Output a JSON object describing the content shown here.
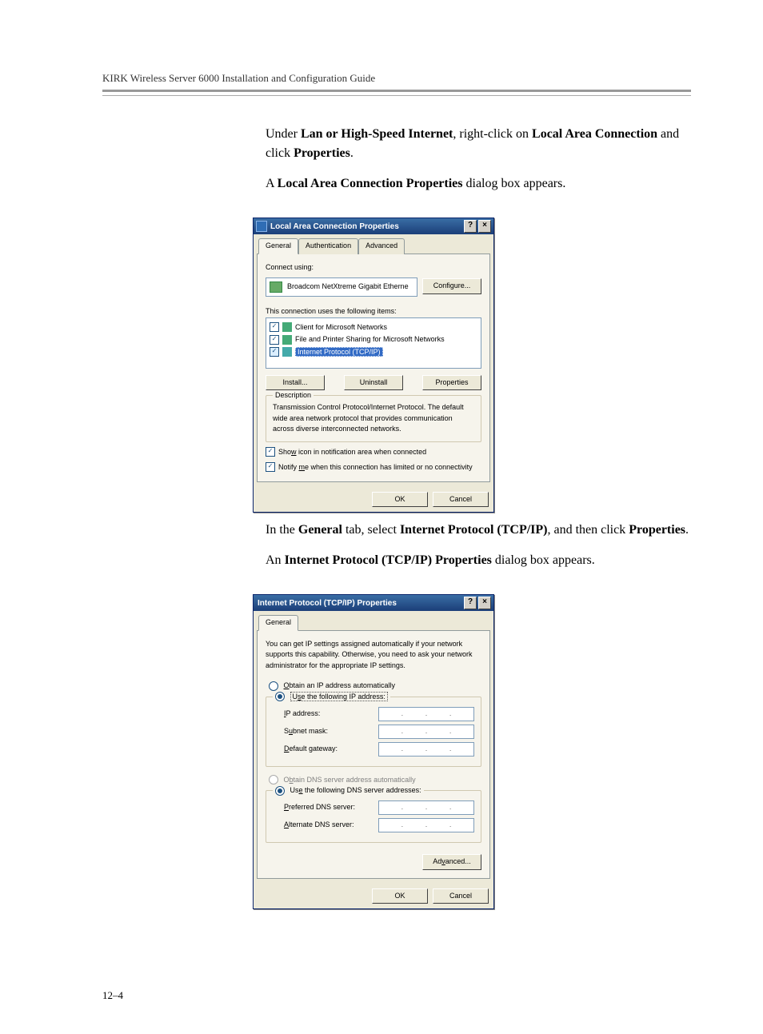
{
  "header": {
    "running": "KIRK Wireless Server 6000 Installation and Configuration Guide"
  },
  "para1_pre": "Under ",
  "para1_b1": "Lan or High-Speed Internet",
  "para1_mid": ", right-click on ",
  "para1_b2": "Local Area Connection",
  "para1_mid2": " and click ",
  "para1_b3": "Properties",
  "para1_end": ".",
  "para2_pre": "A ",
  "para2_b1": "Local Area Connection Properties",
  "para2_end": " dialog box appears.",
  "dlg1": {
    "title": "Local Area Connection Properties",
    "help": "?",
    "close": "×",
    "tabs": {
      "general": "General",
      "auth": "Authentication",
      "adv": "Advanced"
    },
    "connect_using": "Connect using:",
    "device": "Broadcom NetXtreme Gigabit Etherne",
    "configure": "Configure...",
    "uses_items": "This connection uses the following items:",
    "items": {
      "client": "Client for Microsoft Networks",
      "file": "File and Printer Sharing for Microsoft Networks",
      "tcpip": "Internet Protocol (TCP/IP)"
    },
    "install": "Install...",
    "uninstall": "Uninstall",
    "properties": "Properties",
    "desc_legend": "Description",
    "desc_text": "Transmission Control Protocol/Internet Protocol. The default wide area network protocol that provides communication across diverse interconnected networks.",
    "show_icon_pre": "Sho",
    "show_icon_u": "w",
    "show_icon_post": " icon in notification area when connected",
    "notify_pre": "Notify ",
    "notify_u": "m",
    "notify_post": "e when this connection has limited or no connectivity",
    "ok": "OK",
    "cancel": "Cancel"
  },
  "para3_pre": "In the ",
  "para3_b1": "General",
  "para3_mid": " tab, select ",
  "para3_b2": "Internet Protocol (TCP/IP)",
  "para3_mid2": ", and then click ",
  "para3_b3": "Properties",
  "para3_end": ".",
  "para4_pre": "An ",
  "para4_b1": "Internet Protocol (TCP/IP) Properties",
  "para4_end": " dialog box appears.",
  "dlg2": {
    "title": "Internet Protocol (TCP/IP) Properties",
    "help": "?",
    "close": "×",
    "tab_general": "General",
    "intro": "You can get IP settings assigned automatically if your network supports this capability. Otherwise, you need to ask your network administrator for the appropriate IP settings.",
    "r_obtain_ip_u": "O",
    "r_obtain_ip_post": "btain an IP address automatically",
    "r_use_ip_pre": "U",
    "r_use_ip_u": "s",
    "r_use_ip_post": "e the following IP address:",
    "ip_addr_u": "I",
    "ip_addr_post": "P address:",
    "subnet_pre": "S",
    "subnet_u": "u",
    "subnet_post": "bnet mask:",
    "gateway_u": "D",
    "gateway_post": "efault gateway:",
    "r_obtain_dns_pre": "O",
    "r_obtain_dns_u": "b",
    "r_obtain_dns_post": "tain DNS server address automatically",
    "r_use_dns_pre": "Us",
    "r_use_dns_u": "e",
    "r_use_dns_post": " the following DNS server addresses:",
    "pref_dns_u": "P",
    "pref_dns_post": "referred DNS server:",
    "alt_dns_u": "A",
    "alt_dns_post": "lternate DNS server:",
    "advanced_pre": "Ad",
    "advanced_u": "v",
    "advanced_post": "anced...",
    "ok": "OK",
    "cancel": "Cancel"
  },
  "footer": {
    "pagenum": "12–4"
  }
}
